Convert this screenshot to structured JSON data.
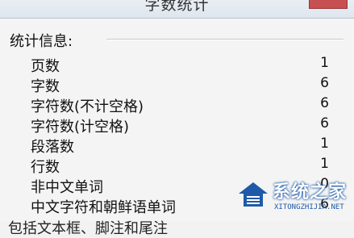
{
  "window": {
    "title": "字数统计"
  },
  "group": {
    "title": "统计信息:"
  },
  "stats": [
    {
      "label": "页数",
      "value": "1"
    },
    {
      "label": "字数",
      "value": "6"
    },
    {
      "label": "字符数(不计空格)",
      "value": "6"
    },
    {
      "label": "字符数(计空格)",
      "value": "6"
    },
    {
      "label": "段落数",
      "value": "1"
    },
    {
      "label": "行数",
      "value": "1"
    },
    {
      "label": "非中文单词",
      "value": "0"
    },
    {
      "label": "中文字符和朝鲜语单词",
      "value": "6"
    }
  ],
  "bottom": {
    "text": "包括文本框、脚注和尾注"
  },
  "watermark": {
    "name": "系统之家",
    "url": "XITONGZHIJIA.NET",
    "colors": {
      "blue": "#1e5aa8"
    }
  }
}
